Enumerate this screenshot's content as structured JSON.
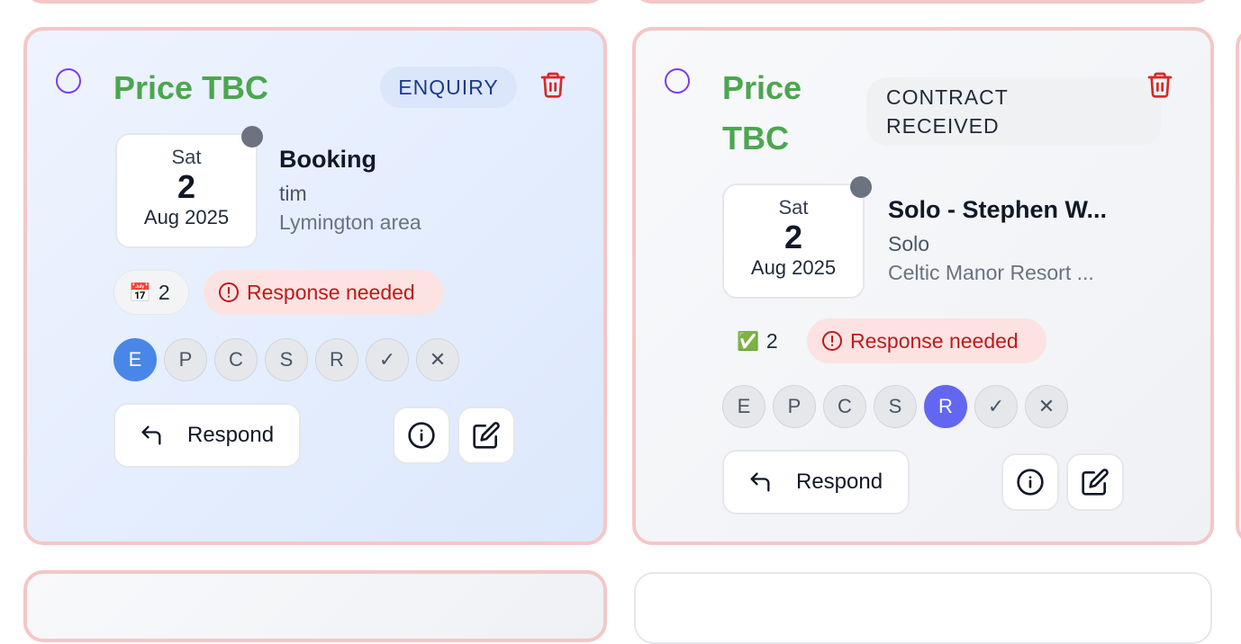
{
  "cards": [
    {
      "price": "Price TBC",
      "status_badge": "ENQUIRY",
      "date": {
        "dow": "Sat",
        "day": "2",
        "month_year": "Aug 2025"
      },
      "title": "Booking",
      "client": "tim",
      "location": "Lymington area",
      "count_icon": "📅",
      "count": "2",
      "response_label": "Response needed",
      "stages": [
        "E",
        "P",
        "C",
        "S",
        "R",
        "✓",
        "✕"
      ],
      "active_stage": "E",
      "respond_label": "Respond"
    },
    {
      "price_line1": "Price",
      "price_line2": "TBC",
      "status_line1": "CONTRACT",
      "status_line2": "RECEIVED",
      "date": {
        "dow": "Sat",
        "day": "2",
        "month_year": "Aug 2025"
      },
      "title": "Solo - Stephen W...",
      "client": "Solo",
      "location": "Celtic Manor Resort ...",
      "count_icon": "✅",
      "count": "2",
      "response_label": "Response needed",
      "stages": [
        "E",
        "P",
        "C",
        "S",
        "R",
        "✓",
        "✕"
      ],
      "active_stage": "R",
      "respond_label": "Respond"
    }
  ],
  "colors": {
    "price_green": "#4ca64f",
    "card_border": "#f4c7c7",
    "active_enquiry": "#4a86e8",
    "active_received": "#6366f1",
    "danger": "#dc2626"
  }
}
